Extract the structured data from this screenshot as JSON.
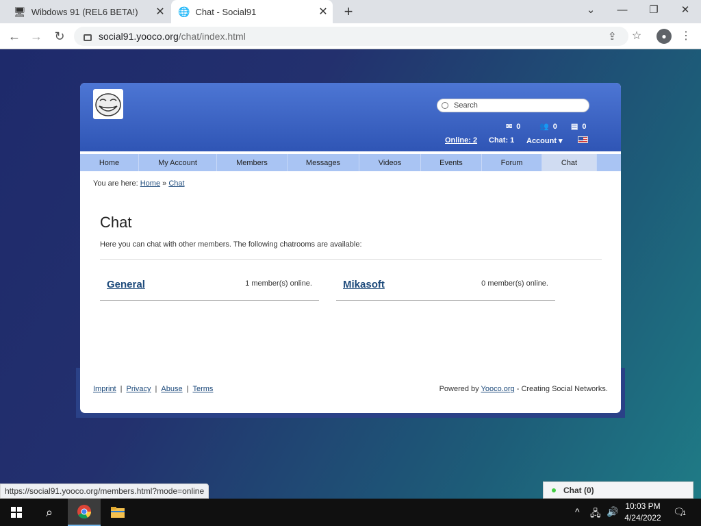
{
  "browser": {
    "tabs": [
      {
        "title": "Wibdows 91 (REL6 BETA!)",
        "active": false
      },
      {
        "title": "Chat - Social91",
        "active": true
      }
    ],
    "url_host": "social91.yooco.org",
    "url_path": "/chat/index.html",
    "status_url": "https://social91.yooco.org/members.html?mode=online"
  },
  "site": {
    "search_placeholder": "Search",
    "counters": {
      "messages": "0",
      "friends": "0",
      "notes": "0"
    },
    "online_link": "Online: 2",
    "chat_count": "Chat: 1",
    "account_label": "Account ▾",
    "menu": [
      "Home",
      "My Account",
      "Members",
      "Messages",
      "Videos",
      "Events",
      "Forum",
      "Chat"
    ],
    "active_menu": "Chat",
    "breadcrumb": {
      "prefix": "You are here:",
      "home": "Home",
      "sep": "»",
      "current": "Chat"
    },
    "heading": "Chat",
    "intro": "Here you can chat with other members. The following chatrooms are available:",
    "rooms": [
      {
        "name": "General",
        "online": "1 member(s) online."
      },
      {
        "name": "Mikasoft",
        "online": "0 member(s) online."
      }
    ],
    "footer": {
      "links": [
        "Imprint",
        "Privacy",
        "Abuse",
        "Terms"
      ],
      "powered_prefix": "Powered by",
      "powered_link": "Yooco.org",
      "powered_suffix": "- Creating Social Networks."
    },
    "chat_widget": "Chat (0)"
  },
  "taskbar": {
    "time": "10:03 PM",
    "date": "4/24/2022",
    "notifications": "1"
  }
}
